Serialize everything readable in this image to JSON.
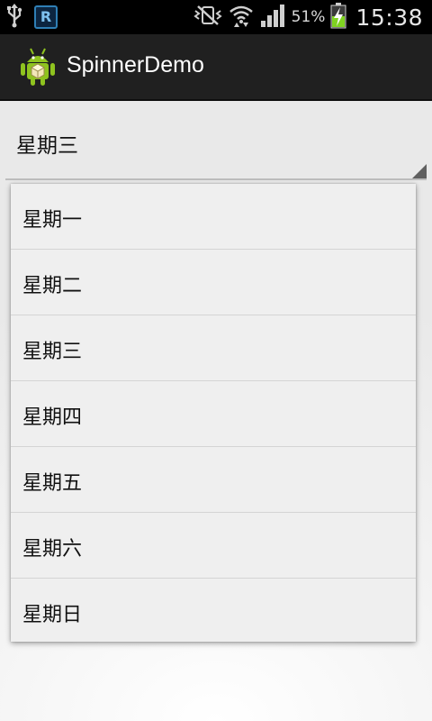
{
  "status_bar": {
    "left_icons": [
      "usb-icon",
      "r-app-icon"
    ],
    "r_badge": "R",
    "right_icons": [
      "mute-vibrate-icon",
      "wifi-icon",
      "signal-icon",
      "battery-charging-icon"
    ],
    "battery_percent": "51%",
    "time": "15:38"
  },
  "action_bar": {
    "title": "SpinnerDemo",
    "icon": "android-robot-icon"
  },
  "spinner": {
    "selected": "星期三"
  },
  "dropdown": {
    "items": [
      "星期一",
      "星期二",
      "星期三",
      "星期四",
      "星期五",
      "星期六",
      "星期日"
    ]
  },
  "colors": {
    "status_bar_bg": "#000000",
    "action_bar_bg": "#202020",
    "battery_green": "#7fd321",
    "android_green": "#8fc31f"
  }
}
